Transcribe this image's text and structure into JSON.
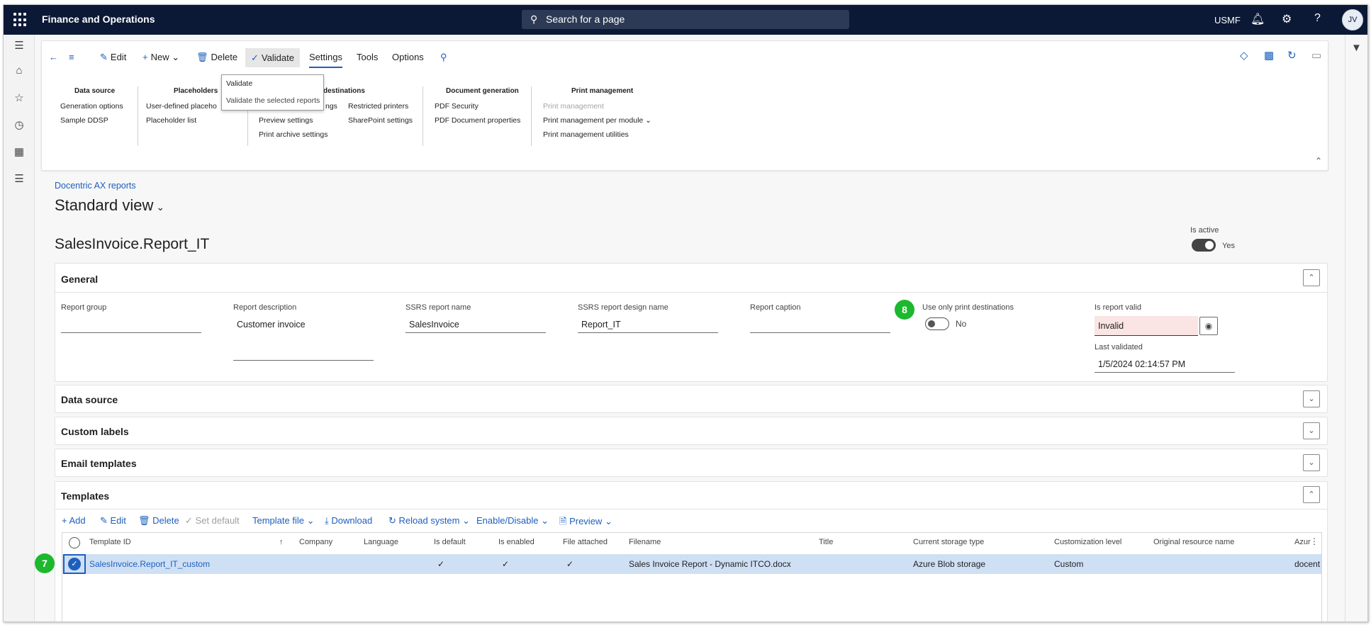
{
  "topbar": {
    "app_title": "Finance and Operations",
    "search_placeholder": "Search for a page",
    "company": "USMF",
    "avatar": "JV"
  },
  "action_pane": {
    "edit": "Edit",
    "new": "New",
    "delete": "Delete",
    "validate": "Validate",
    "tabs": [
      "Settings",
      "Tools",
      "Options"
    ],
    "groups": {
      "data_source": {
        "title": "Data source",
        "items": [
          "Generation options",
          "Sample DDSP"
        ]
      },
      "placeholders": {
        "title": "Placeholders",
        "items": [
          "User-defined placeho",
          "Placeholder list"
        ]
      },
      "destinations": {
        "title": "destinations",
        "items_col1": [
          "ngs",
          "Preview settings",
          "Print archive settings"
        ],
        "items_col2": [
          "Restricted printers",
          "SharePoint settings"
        ]
      },
      "document_generation": {
        "title": "Document generation",
        "items": [
          "PDF Security",
          "PDF Document properties"
        ]
      },
      "print_management": {
        "title": "Print management",
        "items": [
          "Print management",
          "Print management per module",
          "Print management utilities"
        ]
      }
    }
  },
  "validate_menu": {
    "items": [
      "Validate",
      "Validate the selected reports"
    ]
  },
  "page": {
    "breadcrumb": "Docentric AX reports",
    "view": "Standard view",
    "record_title": "SalesInvoice.Report_IT",
    "is_active_label": "Is active",
    "is_active_value": "Yes"
  },
  "general": {
    "header": "General",
    "fields": {
      "report_group": {
        "label": "Report group",
        "value": ""
      },
      "report_description": {
        "label": "Report description",
        "value": "Customer invoice"
      },
      "ssrs_report_name": {
        "label": "SSRS report name",
        "value": "SalesInvoice"
      },
      "ssrs_report_design_name": {
        "label": "SSRS report design name",
        "value": "Report_IT"
      },
      "report_caption": {
        "label": "Report caption",
        "value": ""
      },
      "use_only_print_destinations": {
        "label": "Use only print destinations",
        "value": "No"
      },
      "is_report_valid": {
        "label": "Is report valid",
        "value": "Invalid"
      },
      "last_validated": {
        "label": "Last validated",
        "value": "1/5/2024 02:14:57 PM"
      }
    }
  },
  "sections": [
    "Data source",
    "Custom labels",
    "Email templates"
  ],
  "templates": {
    "header": "Templates",
    "toolbar": {
      "add": "Add",
      "edit": "Edit",
      "delete": "Delete",
      "set_default": "Set default",
      "template_file": "Template file",
      "download": "Download",
      "reload_system": "Reload system",
      "enable_disable": "Enable/Disable",
      "preview": "Preview"
    },
    "columns": [
      "Template ID",
      "Company",
      "Language",
      "Is default",
      "Is enabled",
      "File attached",
      "Filename",
      "Title",
      "Current storage type",
      "Customization level",
      "Original resource name",
      "Azur"
    ],
    "rows": [
      {
        "template_id": "SalesInvoice.Report_IT_custom",
        "company": "",
        "language": "",
        "is_default": true,
        "is_enabled": true,
        "file_attached": true,
        "filename": "Sales Invoice Report - Dynamic ITCO.docx",
        "title": "",
        "storage_type": "Azure Blob storage",
        "customization_level": "Custom",
        "original_resource_name": "",
        "azure": "docent"
      }
    ]
  },
  "badges": {
    "step7": "7",
    "step8": "8"
  },
  "colors": {
    "topbar": "#0b1936",
    "accent": "#1d5fbd",
    "badge": "#1db82e",
    "invalid_bg": "#fbe4e4",
    "selected_row": "#cfe0f5"
  }
}
